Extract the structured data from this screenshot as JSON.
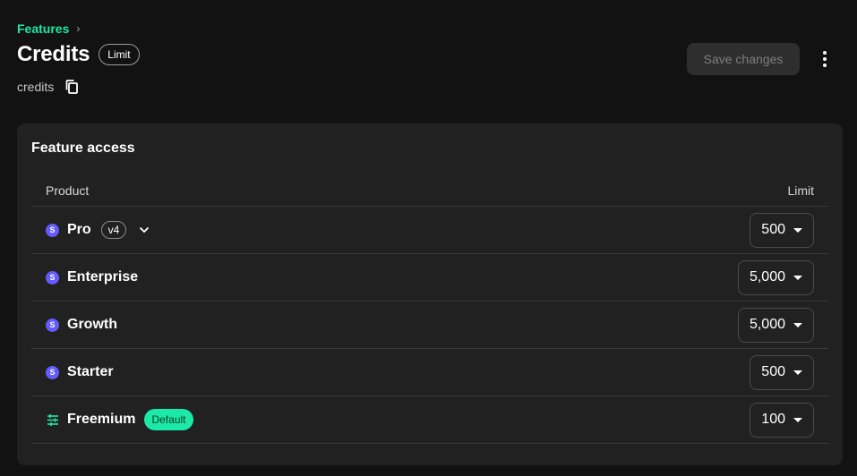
{
  "breadcrumb": {
    "link_label": "Features",
    "separator": "›"
  },
  "header": {
    "title": "Credits",
    "type_badge": "Limit",
    "feature_id": "credits",
    "save_label": "Save changes"
  },
  "card": {
    "title": "Feature access",
    "columns": {
      "product": "Product",
      "limit": "Limit"
    },
    "rows": [
      {
        "name": "Pro",
        "icon": "stripe-icon",
        "version": "v4",
        "limit": "500"
      },
      {
        "name": "Enterprise",
        "icon": "stripe-icon",
        "limit": "5,000"
      },
      {
        "name": "Growth",
        "icon": "stripe-icon",
        "limit": "5,000"
      },
      {
        "name": "Starter",
        "icon": "stripe-icon",
        "limit": "500"
      },
      {
        "name": "Freemium",
        "icon": "sliders-icon",
        "badge": "Default",
        "limit": "100"
      }
    ]
  },
  "icons": {
    "stripe_letter": "S"
  },
  "colors": {
    "accent": "#1de9a6",
    "stripe": "#635bff",
    "background": "#121212",
    "card": "#212121"
  }
}
